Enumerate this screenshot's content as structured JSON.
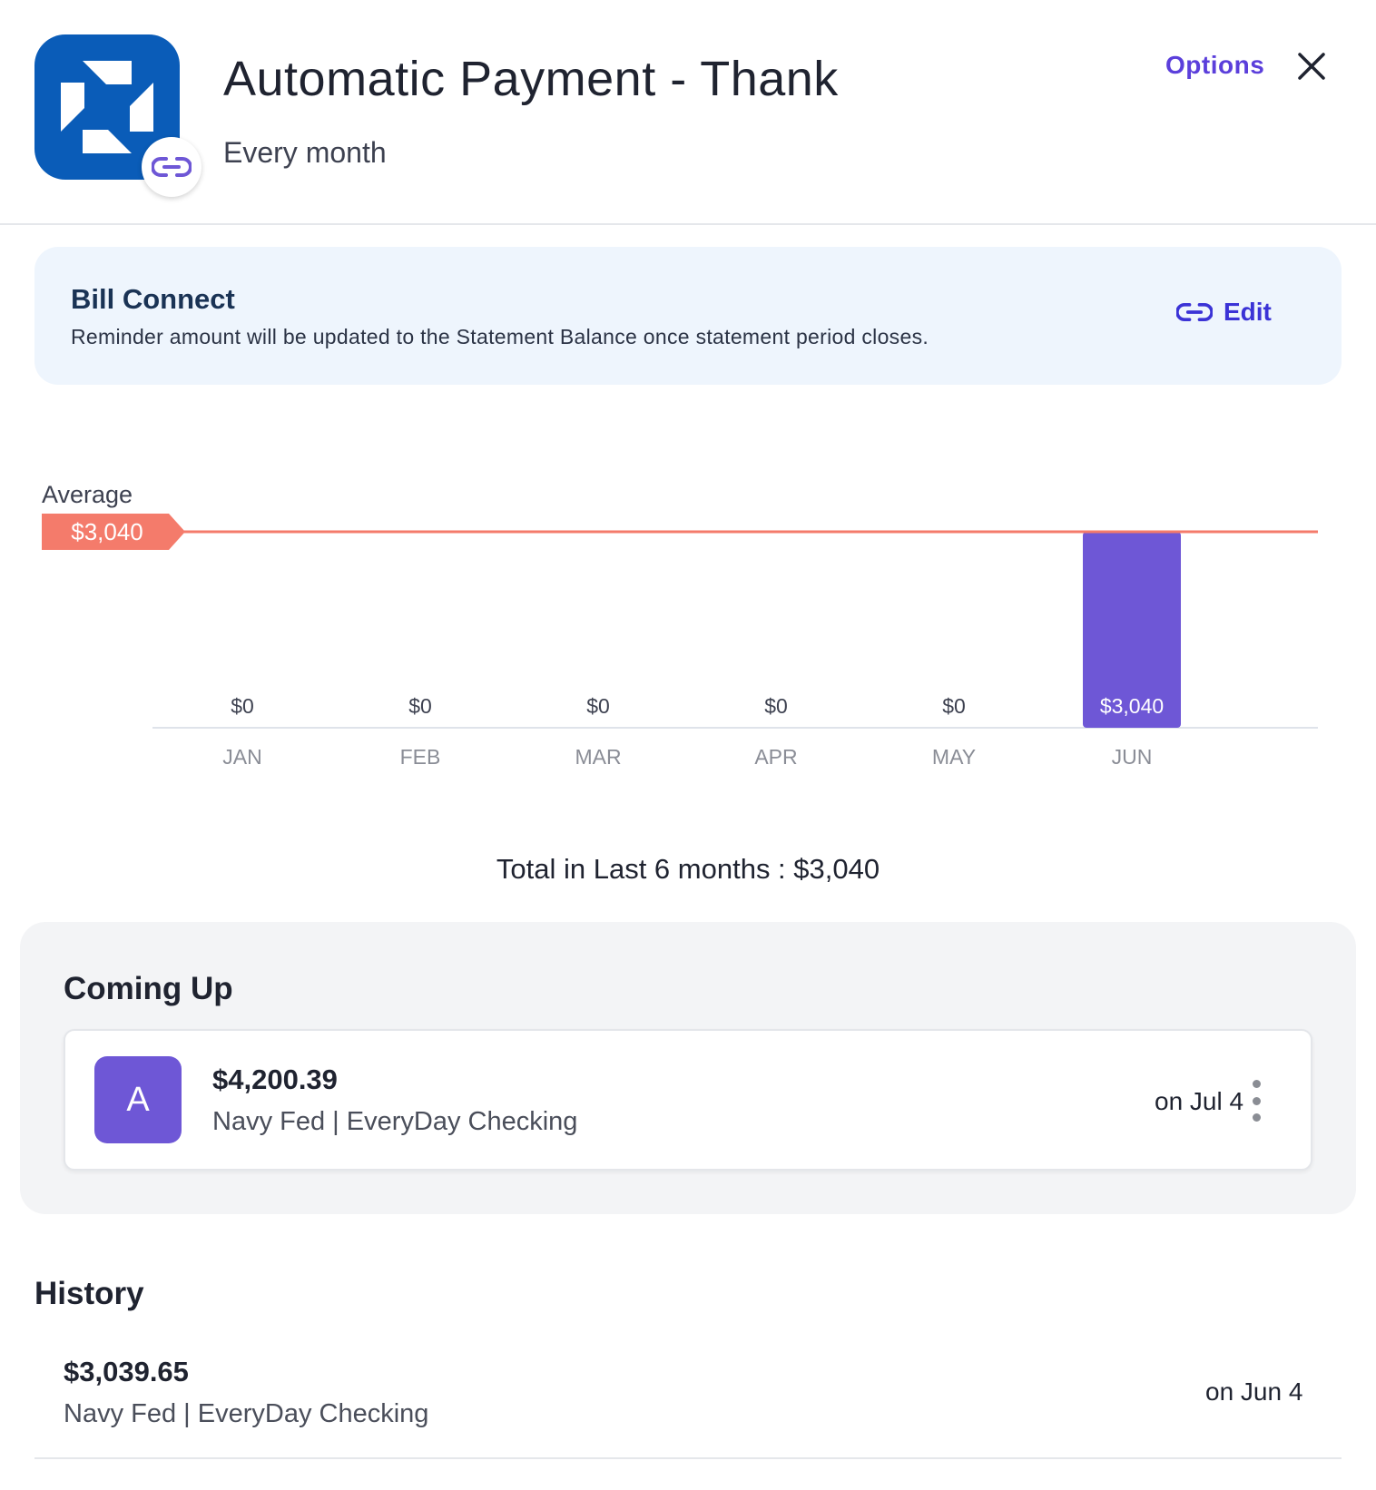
{
  "header": {
    "title": "Automatic Payment - Thank",
    "subtitle": "Every month",
    "options_label": "Options",
    "logo_icon": "bank-octagon-icon",
    "link_icon": "link-icon",
    "close_icon": "close-icon"
  },
  "bill_connect": {
    "title": "Bill Connect",
    "description": "Reminder amount will be updated to the Statement Balance once statement period closes.",
    "edit_label": "Edit"
  },
  "colors": {
    "accent": "#5b3fdb",
    "bar": "#6e57d6",
    "average": "#f47b6b",
    "logo": "#0a5cb8"
  },
  "chart_data": {
    "type": "bar",
    "categories": [
      "JAN",
      "FEB",
      "MAR",
      "APR",
      "MAY",
      "JUN"
    ],
    "values": [
      0,
      0,
      0,
      0,
      0,
      3040
    ],
    "value_labels": [
      "$0",
      "$0",
      "$0",
      "$0",
      "$0",
      "$3,040"
    ],
    "average_label": "Average",
    "average_value": 3040,
    "average_value_label": "$3,040",
    "ylim": [
      0,
      3040
    ]
  },
  "total": {
    "text": "Total in Last 6 months : $3,040"
  },
  "coming_up": {
    "title": "Coming Up",
    "items": [
      {
        "avatar": "A",
        "amount": "$4,200.39",
        "account": "Navy Fed | EveryDay Checking",
        "date": "on Jul 4"
      }
    ]
  },
  "history": {
    "title": "History",
    "items": [
      {
        "amount": "$3,039.65",
        "account": "Navy Fed | EveryDay Checking",
        "date": "on Jun 4"
      }
    ]
  }
}
